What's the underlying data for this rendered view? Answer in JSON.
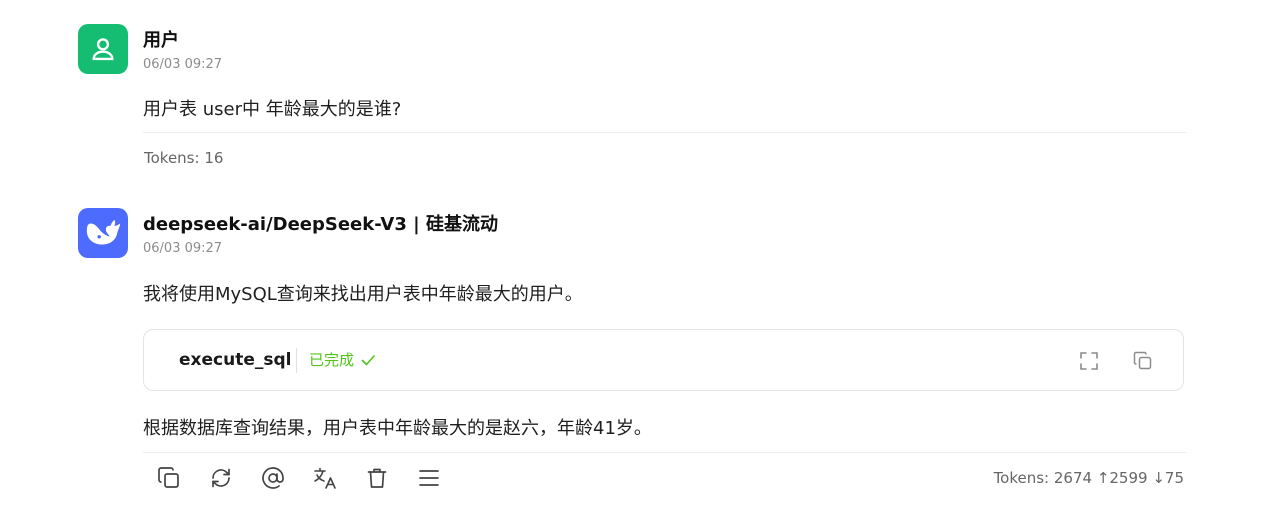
{
  "user_message": {
    "author": "用户",
    "time": "06/03 09:27",
    "text": "用户表 user中 年龄最大的是谁?",
    "tokens": "Tokens: 16",
    "avatar_icon": "user-icon",
    "avatar_color": "#15bd73"
  },
  "assistant_message": {
    "author": "deepseek-ai/DeepSeek-V3 | 硅基流动",
    "time": "06/03 09:27",
    "intro": "我将使用MySQL查询来找出用户表中年龄最大的用户。",
    "tool": {
      "name": "execute_sql",
      "status": "已完成",
      "status_icon": "check-icon",
      "expand_icon": "expand-icon",
      "copy_icon": "copy-icon"
    },
    "result": "根据数据库查询结果，用户表中年龄最大的是赵六，年龄41岁。",
    "tokens": "Tokens: 2674 ↑2599 ↓75",
    "avatar_icon": "whale-icon",
    "avatar_color": "#4d6bfe",
    "actions": [
      {
        "icon": "copy-icon"
      },
      {
        "icon": "refresh-icon"
      },
      {
        "icon": "mention-icon"
      },
      {
        "icon": "translate-icon"
      },
      {
        "icon": "trash-icon"
      },
      {
        "icon": "menu-icon"
      }
    ]
  }
}
